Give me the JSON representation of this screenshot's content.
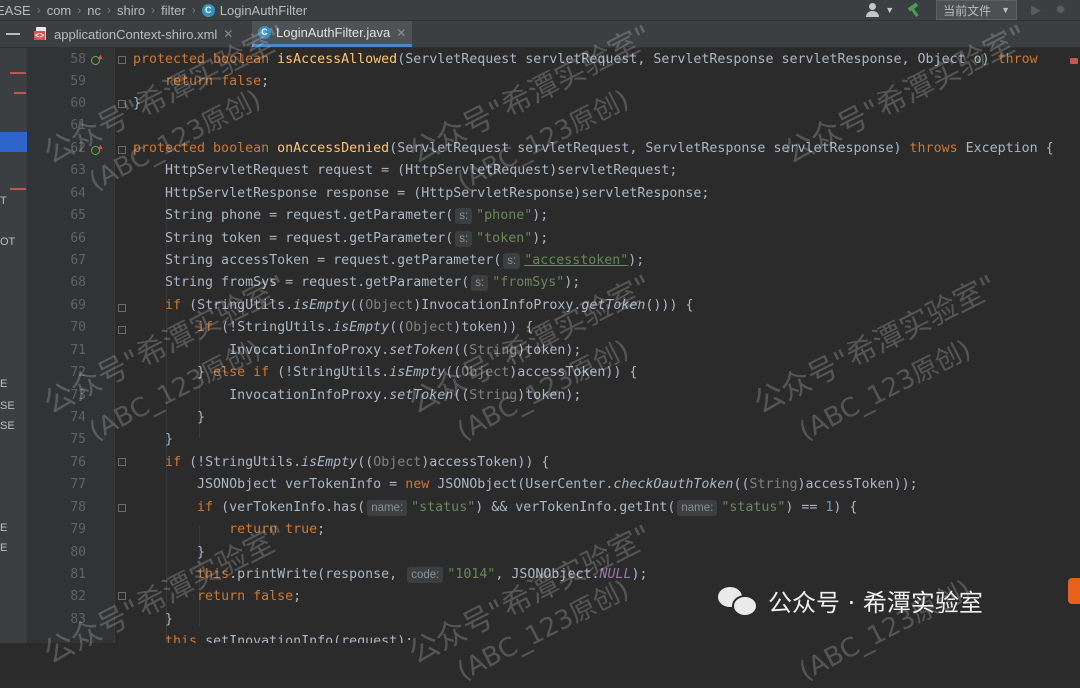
{
  "navbar": {
    "breadcrumbs": [
      "EASE",
      "com",
      "nc",
      "shiro",
      "filter",
      "LoginAuthFilter"
    ],
    "run_config": "当前文件",
    "icons": [
      "user-icon",
      "hammer-icon",
      "run-icon",
      "debug-icon"
    ]
  },
  "tabs": [
    {
      "label": "applicationContext-shiro.xml",
      "active": false
    },
    {
      "label": "LoginAuthFilter.java",
      "active": true
    }
  ],
  "left_strip": {
    "labels": [
      "T",
      "OT",
      "E",
      "SE",
      "SE",
      "E",
      "E"
    ]
  },
  "editor": {
    "line_numbers": [
      "58",
      "59",
      "60",
      "61",
      "62",
      "63",
      "64",
      "65",
      "66",
      "67",
      "68",
      "69",
      "70",
      "71",
      "72",
      "73",
      "74",
      "75",
      "76",
      "77",
      "78",
      "79",
      "80",
      "81",
      "82",
      "83"
    ],
    "hints": {
      "s": "s:",
      "name": "name:",
      "code": "code:"
    },
    "strings": {
      "phone": "\"phone\"",
      "token": "\"token\"",
      "accesstoken": "\"accesstoken\"",
      "fromSys": "\"fromSys\"",
      "status": "\"status\"",
      "code1014": "\"1014\""
    }
  },
  "watermark": {
    "line1": "公众号\"希潭实验室\"",
    "line2": "(ABC_123原创)"
  },
  "brand": {
    "text": "公众号 · 希潭实验室"
  },
  "colors": {
    "keyword": "#cc7832",
    "function": "#ffc66d",
    "string": "#6a8759",
    "number": "#6897bb",
    "background": "#2b2b2b"
  }
}
